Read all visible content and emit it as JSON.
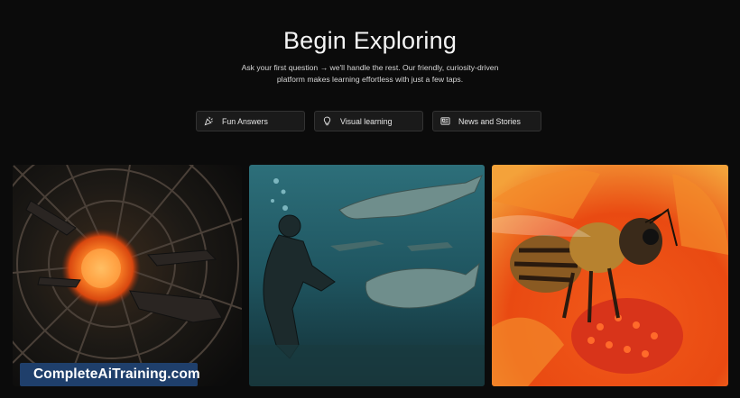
{
  "hero": {
    "title": "Begin Exploring",
    "subtitle_line1": "Ask your first question → we'll handle the rest. Our friendly, curiosity-driven",
    "subtitle_line2": "platform makes learning effortless with just a few taps."
  },
  "chips": [
    {
      "label": "Fun Answers",
      "icon": "party-popper-icon"
    },
    {
      "label": "Visual learning",
      "icon": "lightbulb-icon"
    },
    {
      "label": "News and Stories",
      "icon": "newspaper-icon"
    }
  ],
  "cards": [
    {
      "subject": "space-station-sun-image"
    },
    {
      "subject": "diver-and-sea-reptiles-image"
    },
    {
      "subject": "bee-on-flower-image"
    }
  ],
  "watermark": {
    "text": "CompleteAiTraining.com"
  },
  "colors": {
    "background": "#0b0b0b",
    "chip_bg": "#1a1a1a",
    "watermark_bg": "#1f3f6b"
  }
}
